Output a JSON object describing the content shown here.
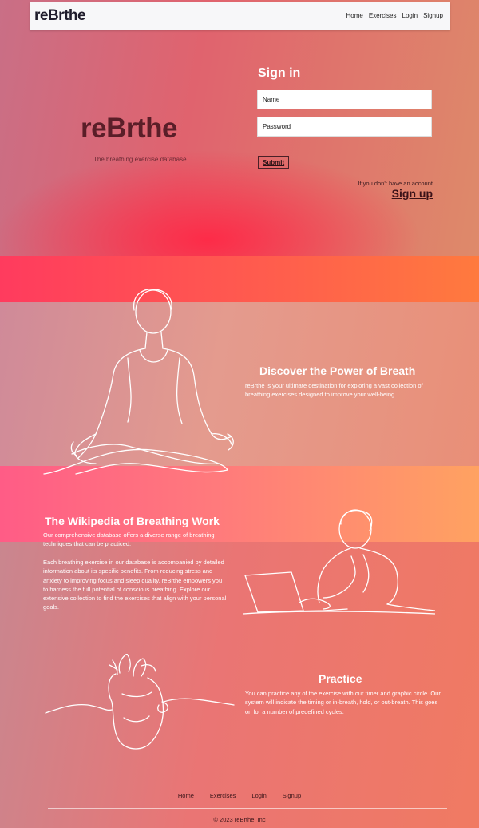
{
  "nav": {
    "logo": "reBrthe",
    "links": [
      "Home",
      "Exercises",
      "Login",
      "Signup"
    ]
  },
  "hero": {
    "brand": "reBrthe",
    "tagline": "The breathing exercise database"
  },
  "signin": {
    "title": "Sign in",
    "name_placeholder": "Name",
    "password_placeholder": "Password",
    "submit_label": "Submit",
    "account_note": "If you don't have an account",
    "signup_label": "Sign up"
  },
  "sections": {
    "discover": {
      "title": "Discover the Power of Breath",
      "text": "reBrthe is your ultimate destination for exploring a vast collection of breathing exercises designed to improve your well-being."
    },
    "wikipedia": {
      "title": "The Wikipedia of Breathing Work",
      "text1": "Our comprehensive database offers a diverse range of breathing techniques that can be practiced.",
      "text2": "Each breathing exercise in our database is accompanied by detailed information about its specific benefits. From reducing stress and anxiety to improving focus and sleep quality, reBrthe empowers you to harness the full potential of conscious breathing. Explore our extensive collection to find the exercises that align with your personal goals."
    },
    "practice": {
      "title": "Practice",
      "text": "You can practice any of the exercise with our timer and graphic circle. Our system will indicate the timing or in-breath, hold, or out-breath. This goes on for a number of predefined cycles."
    }
  },
  "illustrations": [
    "meditation-figure-icon",
    "laptop-person-icon",
    "heart-icon"
  ],
  "footer": {
    "links": [
      "Home",
      "Exercises",
      "Login",
      "Signup"
    ],
    "copyright": "© 2023 reBrthe, Inc"
  },
  "colors": {
    "brand_dark": "#5a1e28",
    "hot_pink": "#ff3b5e",
    "orange": "#ffa261",
    "nav_bg": "#f7f7f9"
  }
}
